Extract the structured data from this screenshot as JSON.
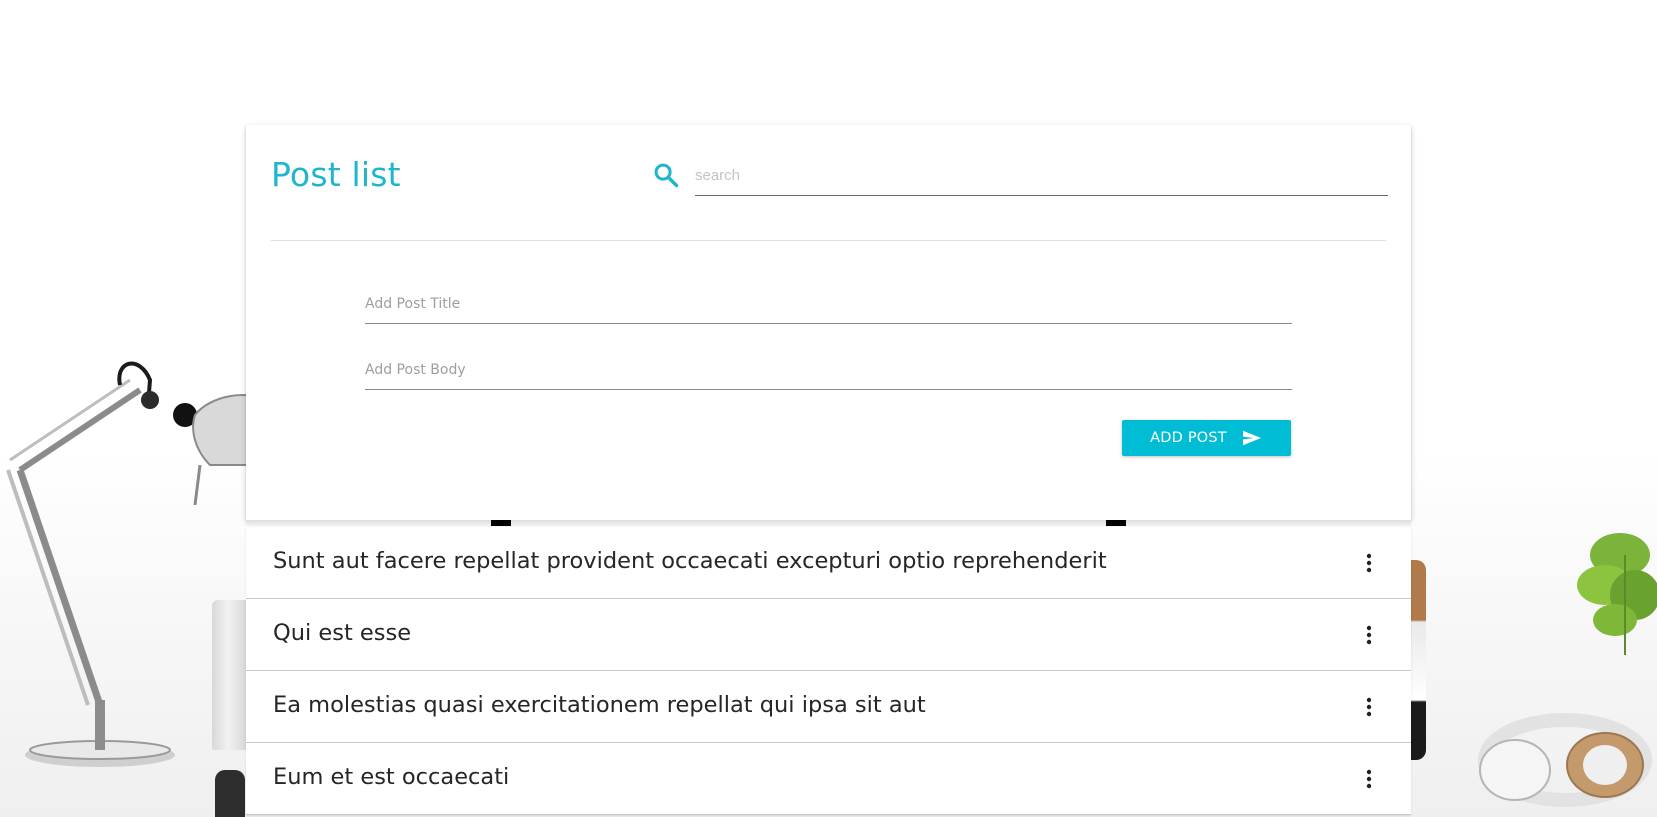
{
  "header": {
    "title": "Post list",
    "search_placeholder": "search",
    "search_icon": "search-icon"
  },
  "form": {
    "title_placeholder": "Add Post Title",
    "body_placeholder": "Add Post Body",
    "submit_label": "ADD POST",
    "submit_icon": "send-icon"
  },
  "posts": [
    {
      "title": "Sunt aut facere repellat provident occaecati excepturi optio reprehenderit",
      "menu_icon": "more-vert-icon"
    },
    {
      "title": "Qui est esse",
      "menu_icon": "more-vert-icon"
    },
    {
      "title": "Ea molestias quasi exercitationem repellat qui ipsa sit aut",
      "menu_icon": "more-vert-icon"
    },
    {
      "title": "Eum et est occaecati",
      "menu_icon": "more-vert-icon"
    }
  ],
  "colors": {
    "accent": "#00bcd4",
    "title": "#1fb6cd",
    "text": "#262626"
  }
}
